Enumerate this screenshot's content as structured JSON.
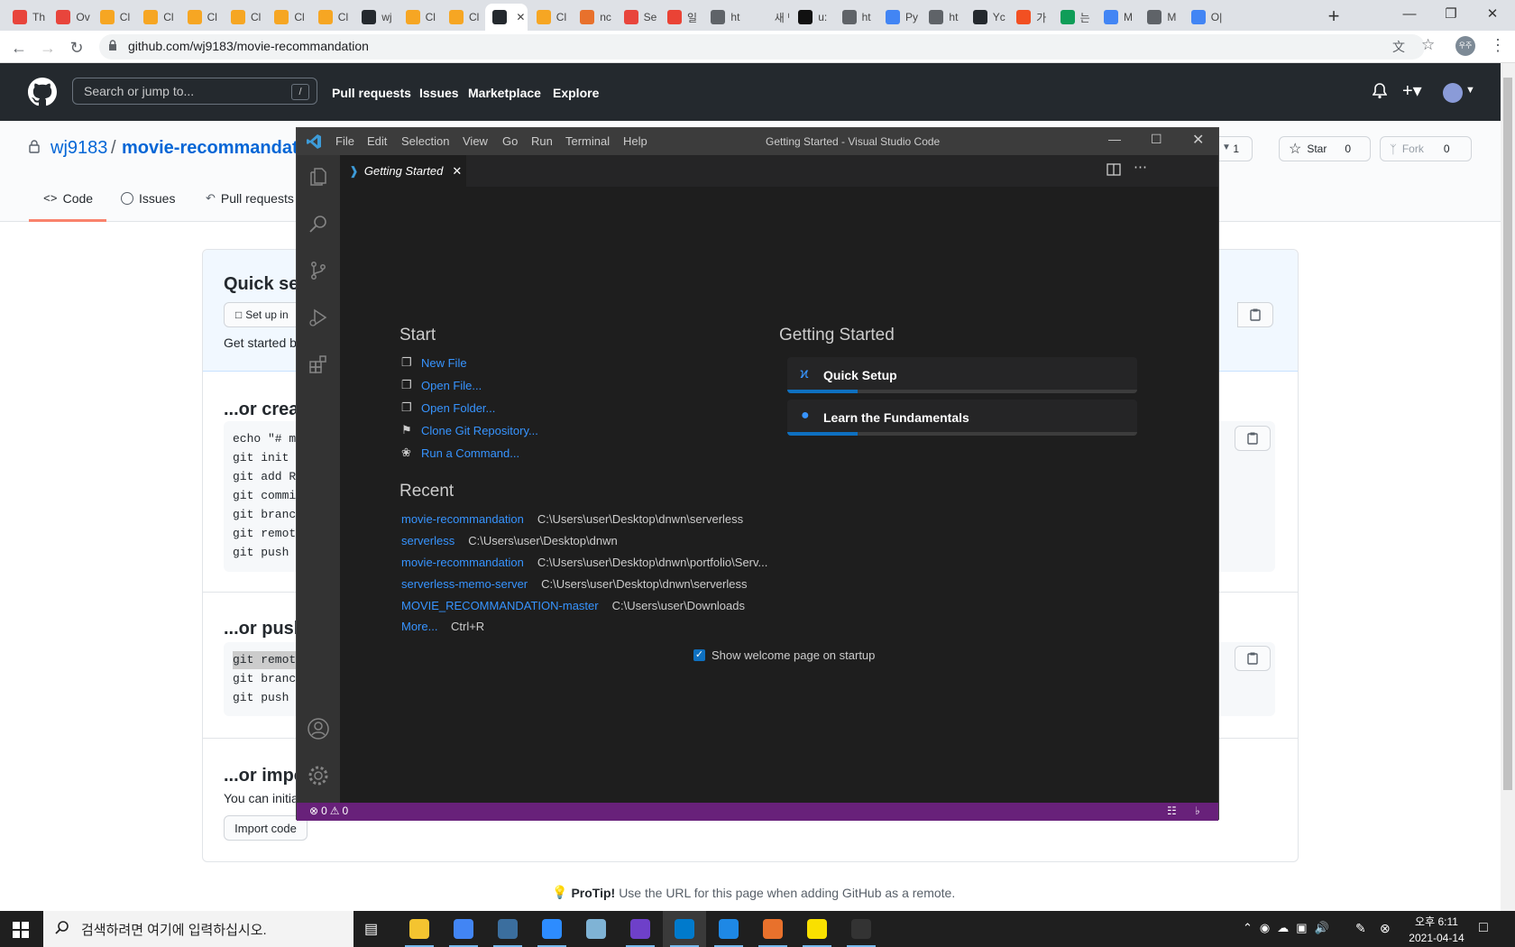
{
  "browser": {
    "tabs": [
      {
        "label": "Th",
        "color": "#e8453c"
      },
      {
        "label": "Ov",
        "color": "#e8453c"
      },
      {
        "label": "Cl",
        "color": "#f6a623"
      },
      {
        "label": "Cl",
        "color": "#f6a623"
      },
      {
        "label": "Cl",
        "color": "#f6a623"
      },
      {
        "label": "Cl",
        "color": "#f6a623"
      },
      {
        "label": "Cl",
        "color": "#f6a623"
      },
      {
        "label": "Cl",
        "color": "#f6a623"
      },
      {
        "label": "wj",
        "color": "#24292e"
      },
      {
        "label": "Cl",
        "color": "#f6a623"
      },
      {
        "label": "Cl",
        "color": "#f6a623"
      },
      {
        "label": "",
        "color": "#24292e",
        "active": true
      },
      {
        "label": "Cl",
        "color": "#f6a623"
      },
      {
        "label": "nc",
        "color": "#e8712c"
      },
      {
        "label": "Se",
        "color": "#e8453c"
      },
      {
        "label": "일",
        "color": "#ea4335"
      },
      {
        "label": "ht",
        "color": "#5f6368"
      },
      {
        "label": "새 탭",
        "color": "#dee1e6"
      },
      {
        "label": "u:",
        "color": "#111111"
      },
      {
        "label": "ht",
        "color": "#5f6368"
      },
      {
        "label": "Py",
        "color": "#4285f4"
      },
      {
        "label": "ht",
        "color": "#5f6368"
      },
      {
        "label": "Yc",
        "color": "#24292e"
      },
      {
        "label": "가",
        "color": "#f25022"
      },
      {
        "label": "는",
        "color": "#0f9d58"
      },
      {
        "label": "M",
        "color": "#4285f4"
      },
      {
        "label": "M",
        "color": "#5f6368"
      },
      {
        "label": "O|",
        "color": "#4285f4"
      }
    ],
    "url": "github.com/wj9183/movie-recommandation",
    "profile": "우주"
  },
  "github": {
    "search_placeholder": "Search or jump to...",
    "slash": "/",
    "nav": [
      "Pull requests",
      "Issues",
      "Marketplace",
      "Explore"
    ],
    "owner": "wj9183",
    "sep": "/",
    "repo": "movie-recommandati",
    "watch_count": "1",
    "star_label": "Star",
    "star_count": "0",
    "fork_label": "Fork",
    "fork_count": "0",
    "tabs": {
      "code": "Code",
      "issues": "Issues",
      "pulls": "Pull requests"
    },
    "quick_title": "Quick se",
    "setup_btn": "Set up in",
    "get_started": "Get started b",
    "create_title": "...or crea",
    "create_lines": [
      "echo \"# m",
      "git init",
      "git add R",
      "git commi",
      "git branc",
      "git remot",
      "git push"
    ],
    "push_title": "...or push",
    "push_lines": [
      "git remot",
      "git branc",
      "git push"
    ],
    "import_title": "...or impo",
    "import_text": "You can initia",
    "import_btn": "Import code",
    "protip_bold": "ProTip!",
    "protip_text": "Use the URL for this page when adding GitHub as a remote."
  },
  "vscode": {
    "menu": [
      "File",
      "Edit",
      "Selection",
      "View",
      "Go",
      "Run",
      "Terminal",
      "Help"
    ],
    "title": "Getting Started - Visual Studio Code",
    "tab_label": "Getting Started",
    "start_heading": "Start",
    "start_items": [
      "New File",
      "Open File...",
      "Open Folder...",
      "Clone Git Repository...",
      "Run a Command..."
    ],
    "recent_heading": "Recent",
    "recent": [
      {
        "name": "movie-recommandation",
        "path": "C:\\Users\\user\\Desktop\\dnwn\\serverless"
      },
      {
        "name": "serverless",
        "path": "C:\\Users\\user\\Desktop\\dnwn"
      },
      {
        "name": "movie-recommandation",
        "path": "C:\\Users\\user\\Desktop\\dnwn\\portfolio\\Serv..."
      },
      {
        "name": "serverless-memo-server",
        "path": "C:\\Users\\user\\Desktop\\dnwn\\serverless"
      },
      {
        "name": "MOVIE_RECOMMANDATION-master",
        "path": "C:\\Users\\user\\Downloads"
      }
    ],
    "more_label": "More...",
    "more_shortcut": "Ctrl+R",
    "gs_heading": "Getting Started",
    "cards": [
      {
        "title": "Quick Setup",
        "progress": 0.2
      },
      {
        "title": "Learn the Fundamentals",
        "progress": 0.2
      }
    ],
    "show_welcome": "Show welcome page on startup",
    "errors": "0",
    "warnings": "0",
    "accent": "#68217a"
  },
  "taskbar": {
    "search_placeholder": "검색하려면 여기에 입력하십시오.",
    "time": "오후 6:11",
    "date": "2021-04-14",
    "apps": [
      {
        "name": "file-explorer",
        "color": "#f4c430"
      },
      {
        "name": "chrome",
        "color": "#4285f4"
      },
      {
        "name": "mysql-workbench",
        "color": "#3b6e9e"
      },
      {
        "name": "zoom",
        "color": "#2d8cff"
      },
      {
        "name": "app",
        "color": "#7fb3d5"
      },
      {
        "name": "github-desktop",
        "color": "#6e40c9"
      },
      {
        "name": "vscode",
        "color": "#007acc"
      },
      {
        "name": "media-player",
        "color": "#1e88e5"
      },
      {
        "name": "office",
        "color": "#e8712c"
      },
      {
        "name": "kakaotalk",
        "color": "#f9e000"
      },
      {
        "name": "terminal",
        "color": "#333333"
      }
    ]
  }
}
